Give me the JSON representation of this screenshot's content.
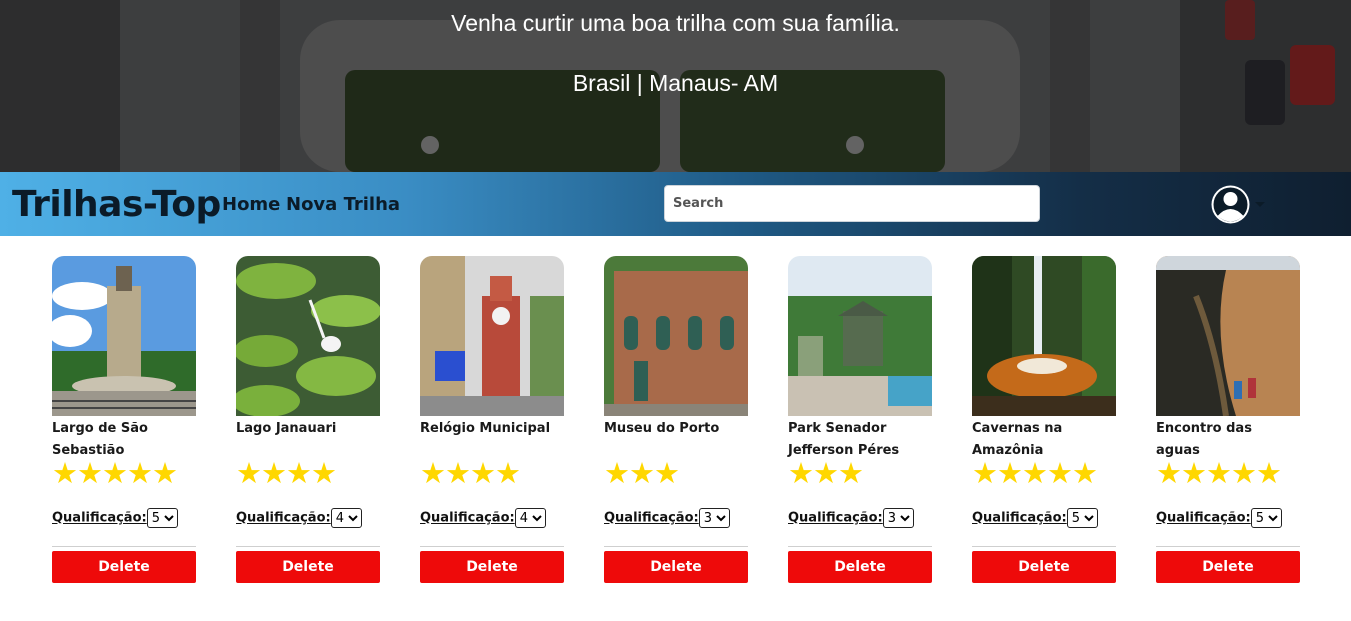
{
  "hero": {
    "line1": "Venha curtir uma boa trilha com sua família.",
    "line2": "Brasil | Manaus- AM"
  },
  "navbar": {
    "brand": "Trilhas-Top",
    "links": [
      "Home",
      "Nova Trilha"
    ],
    "search_placeholder": "Search",
    "search_value": "",
    "avatar_icon": "user-circle-icon"
  },
  "colors": {
    "delete": "#ee0a0a",
    "star": "#ffd700",
    "navbar_left": "#4fb0e6",
    "navbar_right": "#0f1f30"
  },
  "cards": [
    {
      "title": "Largo de São Sebastião",
      "stars": "★★★★★",
      "rating_label": "Qualificação:",
      "rating": "5",
      "delete_label": "Delete"
    },
    {
      "title": "Lago Janauari",
      "stars": "★★★★",
      "rating_label": "Qualificação:",
      "rating": "4",
      "delete_label": "Delete"
    },
    {
      "title": "Relógio Municipal",
      "stars": "★★★★",
      "rating_label": "Qualificação:",
      "rating": "4",
      "delete_label": "Delete"
    },
    {
      "title": "Museu do Porto",
      "stars": "★★★",
      "rating_label": "Qualificação:",
      "rating": "3",
      "delete_label": "Delete"
    },
    {
      "title": "Park Senador Jefferson Péres",
      "stars": "★★★",
      "rating_label": "Qualificação:",
      "rating": "3",
      "delete_label": "Delete"
    },
    {
      "title": "Cavernas na Amazônia",
      "stars": "★★★★★",
      "rating_label": "Qualificação:",
      "rating": "5",
      "delete_label": "Delete"
    },
    {
      "title": "Encontro das aguas",
      "stars": "★★★★★",
      "rating_label": "Qualificação:",
      "rating": "5",
      "delete_label": "Delete"
    }
  ]
}
